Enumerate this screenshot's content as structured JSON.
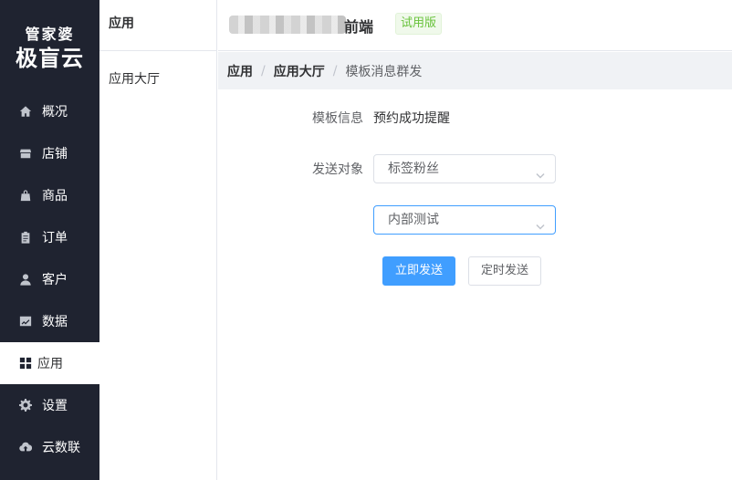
{
  "logo": {
    "line1": "管家婆",
    "line2": "极盲云"
  },
  "nav": [
    {
      "label": "概况",
      "icon": "home-icon"
    },
    {
      "label": "店铺",
      "icon": "shop-icon"
    },
    {
      "label": "商品",
      "icon": "bag-icon"
    },
    {
      "label": "订单",
      "icon": "clipboard-icon"
    },
    {
      "label": "客户",
      "icon": "user-icon"
    },
    {
      "label": "数据",
      "icon": "chart-icon"
    },
    {
      "label": "应用",
      "icon": "grid-icon",
      "active": true
    },
    {
      "label": "设置",
      "icon": "gear-icon"
    },
    {
      "label": "云数联",
      "icon": "cloud-upload-icon"
    }
  ],
  "submenu": {
    "title": "应用",
    "items": [
      "应用大厅"
    ]
  },
  "header": {
    "shop_name_suffix": "前端",
    "trial_badge": "试用版"
  },
  "breadcrumb": {
    "items": [
      "应用",
      "应用大厅",
      "模板消息群发"
    ],
    "separator": "/"
  },
  "form": {
    "template_info_label": "模板信息",
    "template_info_value": "预约成功提醒",
    "send_target_label": "发送对象",
    "send_target_value": "标签粉丝",
    "tag_value": "内部测试",
    "send_now_button": "立即发送",
    "schedule_send_button": "定时发送"
  },
  "colors": {
    "sidebar_bg": "#1f2330",
    "primary": "#409eff",
    "trial_green": "#67c23a",
    "breadcrumb_bg": "#f0f2f5"
  }
}
